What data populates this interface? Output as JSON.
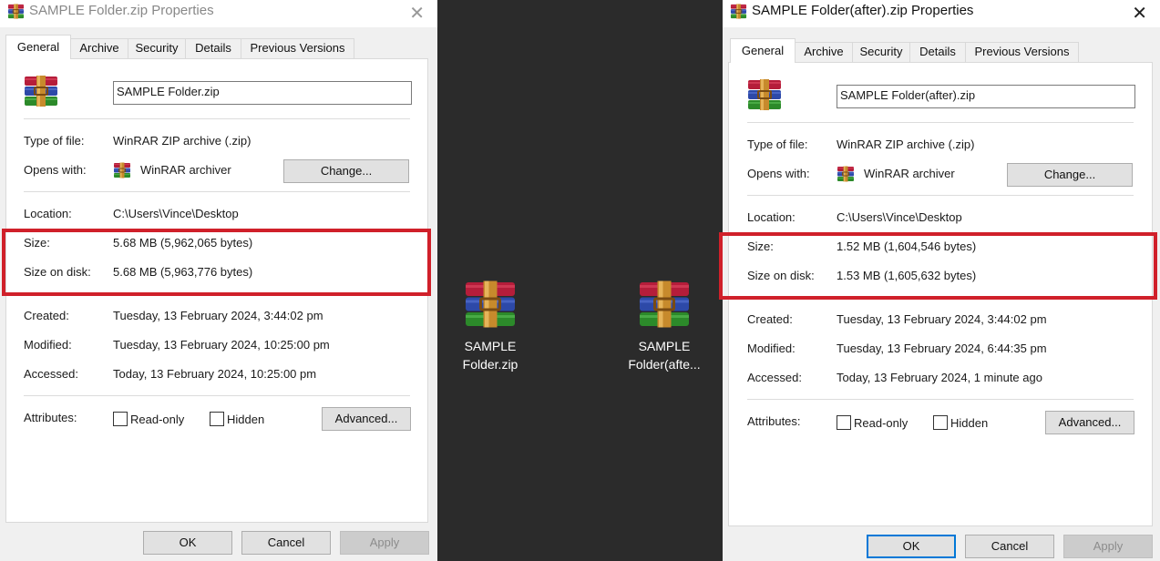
{
  "colors": {
    "highlight": "#d0202a",
    "desktop": "#2b2b2b",
    "accent": "#0078d7"
  },
  "icons": {
    "archive": "winrar-archive-icon",
    "close": "close-icon"
  },
  "left_dialog": {
    "title": "SAMPLE Folder.zip Properties",
    "close": "✕",
    "tabs": [
      "General",
      "Archive",
      "Security",
      "Details",
      "Previous Versions"
    ],
    "active_tab": "General",
    "file_name": "SAMPLE Folder.zip",
    "type_label": "Type of file:",
    "type_value": "WinRAR ZIP archive (.zip)",
    "opens_label": "Opens with:",
    "opens_value": "WinRAR archiver",
    "change_button": "Change...",
    "location_label": "Location:",
    "location_value": "C:\\Users\\Vince\\Desktop",
    "size_label": "Size:",
    "size_value": "5.68 MB (5,962,065 bytes)",
    "size_on_disk_label": "Size on disk:",
    "size_on_disk_value": "5.68 MB (5,963,776 bytes)",
    "created_label": "Created:",
    "created_value": "Tuesday, 13 February 2024, 3:44:02 pm",
    "modified_label": "Modified:",
    "modified_value": "Tuesday, 13 February 2024, 10:25:00 pm",
    "accessed_label": "Accessed:",
    "accessed_value": "Today, 13 February 2024, 10:25:00 pm",
    "attributes_label": "Attributes:",
    "readonly_label": "Read-only",
    "hidden_label": "Hidden",
    "advanced_button": "Advanced...",
    "ok_button": "OK",
    "cancel_button": "Cancel",
    "apply_button": "Apply"
  },
  "desktop": {
    "items": [
      {
        "label_line1": "SAMPLE",
        "label_line2": "Folder.zip"
      },
      {
        "label_line1": "SAMPLE",
        "label_line2": "Folder(afte..."
      }
    ]
  },
  "right_dialog": {
    "title": "SAMPLE Folder(after).zip Properties",
    "close": "✕",
    "tabs": [
      "General",
      "Archive",
      "Security",
      "Details",
      "Previous Versions"
    ],
    "active_tab": "General",
    "file_name": "SAMPLE Folder(after).zip",
    "type_label": "Type of file:",
    "type_value": "WinRAR ZIP archive (.zip)",
    "opens_label": "Opens with:",
    "opens_value": "WinRAR archiver",
    "change_button": "Change...",
    "location_label": "Location:",
    "location_value": "C:\\Users\\Vince\\Desktop",
    "size_label": "Size:",
    "size_value": "1.52 MB (1,604,546 bytes)",
    "size_on_disk_label": "Size on disk:",
    "size_on_disk_value": "1.53 MB (1,605,632 bytes)",
    "created_label": "Created:",
    "created_value": "Tuesday, 13 February 2024, 3:44:02 pm",
    "modified_label": "Modified:",
    "modified_value": "Tuesday, 13 February 2024, 6:44:35 pm",
    "accessed_label": "Accessed:",
    "accessed_value": "Today, 13 February 2024, 1 minute ago",
    "attributes_label": "Attributes:",
    "readonly_label": "Read-only",
    "hidden_label": "Hidden",
    "advanced_button": "Advanced...",
    "ok_button": "OK",
    "cancel_button": "Cancel",
    "apply_button": "Apply"
  }
}
